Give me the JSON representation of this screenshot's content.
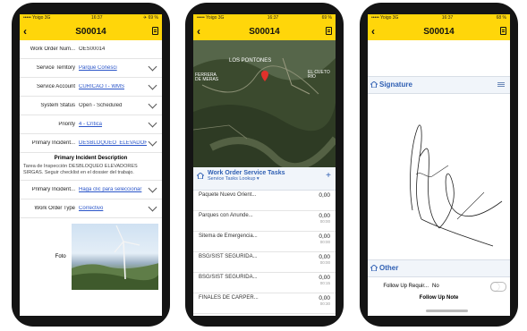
{
  "status_bar": {
    "carrier": "••••• Yoigo 3G",
    "time": "16:37",
    "battery_1": "✈ 69 %",
    "battery_2": "69 %",
    "battery_3": "68 %"
  },
  "header": {
    "title": "S00014",
    "back_icon": "chevron-left-icon",
    "doc_icon": "document-icon"
  },
  "screen1": {
    "fields": [
      {
        "label": "Work Order Num...",
        "value": "OES00014",
        "link": false,
        "chevron": false
      },
      {
        "label": "Service Territory",
        "value": "Parque Conesci",
        "link": true,
        "chevron": true
      },
      {
        "label": "Service Account",
        "value": "CURICAO I - WMS",
        "link": true,
        "chevron": true
      },
      {
        "label": "System Status",
        "value": "Open - Scheduled",
        "link": false,
        "chevron": true
      },
      {
        "label": "Priority",
        "value": "4 - Crítica",
        "link": true,
        "chevron": true
      },
      {
        "label": "Primary Incident...",
        "value": "DESBLOQUEO_ELEVADORES S...",
        "link": true,
        "chevron": true
      }
    ],
    "description_title": "Primary Incident Description",
    "description_text": "Tarea de Inspección DESBLOQUEO ELEVADORES SIRGAS. Seguir checklist en el dossier del trabajo.",
    "fields2": [
      {
        "label": "Primary Incident...",
        "value": "Haga clic para seleccionar",
        "link": true,
        "chevron": true
      },
      {
        "label": "Work Order Type",
        "value": "Correctivo",
        "link": true,
        "chevron": true
      }
    ],
    "photo_label": "Foto"
  },
  "screen2": {
    "map_labels": {
      "place1": "LOS PONTONES",
      "place2": "FERRERA\nDE MERAS",
      "place3": "EL CUETO\nRIO"
    },
    "section_title": "Work Order Service Tasks",
    "section_subtitle": "Service Tasks Lookup ▾",
    "tasks": [
      {
        "name": "Paquete Nuevo Orient...",
        "value": "0,00",
        "sub": ""
      },
      {
        "name": "Parques con Anunde...",
        "value": "0,00",
        "sub": "00:00"
      },
      {
        "name": "Sitema de Emergencia...",
        "value": "0,00",
        "sub": "00:00"
      },
      {
        "name": "BSG/SIST SEGURIDA...",
        "value": "0,00",
        "sub": "00:00"
      },
      {
        "name": "BSG/SIST SEGURIDA...",
        "value": "0,00",
        "sub": "00:15"
      },
      {
        "name": "FINALES DE CARPER...",
        "value": "0,00",
        "sub": "00:30"
      }
    ]
  },
  "screen3": {
    "signature_title": "Signature",
    "other_title": "Other",
    "follow_label": "Follow Up Requir...",
    "follow_value": "No",
    "follow_note": "Follow Up Note"
  }
}
